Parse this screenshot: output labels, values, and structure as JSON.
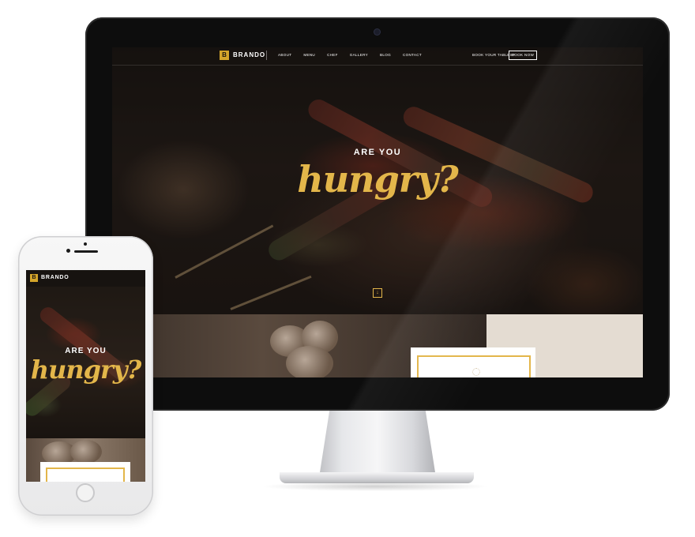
{
  "desktop": {
    "nav": {
      "logo_letter": "B",
      "logo_name": "BRANDO",
      "links": [
        "ABOUT",
        "MENU",
        "CHEF",
        "GALLERY",
        "BLOG",
        "CONTACT"
      ],
      "book_text": "BOOK YOUR TABLES?",
      "book_button": "BOOK NOW"
    },
    "hero": {
      "kicker": "ARE YOU",
      "headline": "hungry?",
      "scroll_icon": "arrow-down-icon"
    }
  },
  "mobile": {
    "header": {
      "logo_letter": "B",
      "logo_name": "BRANDO"
    },
    "hero": {
      "kicker": "ARE YOU",
      "headline": "hungry?"
    }
  },
  "colors": {
    "accent": "#e3b64a",
    "logo": "#d4a52a",
    "dark": "#161210"
  }
}
